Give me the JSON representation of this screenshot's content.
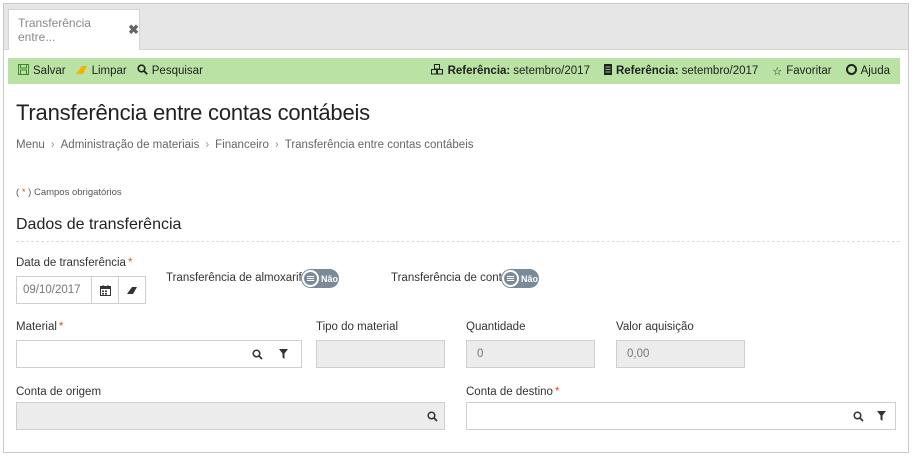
{
  "tab": {
    "label": "Transferência entre...",
    "close": "✖"
  },
  "toolbar": {
    "save_label": "Salvar",
    "clear_label": "Limpar",
    "search_label": "Pesquisar",
    "ref1_label": "Referência:",
    "ref1_value": "setembro/2017",
    "ref2_label": "Referência:",
    "ref2_value": "setembro/2017",
    "favorite_label": "Favoritar",
    "help_label": "Ajuda"
  },
  "page": {
    "title": "Transferência entre contas contábeis",
    "breadcrumb": [
      "Menu",
      "Administração de materiais",
      "Financeiro",
      "Transferência entre contas contábeis"
    ],
    "breadcrumb_sep": "›",
    "required_note_open": "( ",
    "required_note_star": "*",
    "required_note_rest": " ) Campos obrigatórios"
  },
  "section": {
    "title": "Dados de transferência"
  },
  "form": {
    "date_label": "Data de transferência",
    "date_value": "09/10/2017",
    "transfer_almox_label": "Transferência de almoxarifado",
    "transfer_almox_state": "Não",
    "transfer_contas_label": "Transferência de contas",
    "transfer_contas_state": "Não",
    "material_label": "Material",
    "tipo_material_label": "Tipo do material",
    "quantidade_label": "Quantidade",
    "quantidade_value": "0",
    "valor_label": "Valor aquisição",
    "valor_value": "0,00",
    "conta_origem_label": "Conta de origem",
    "conta_destino_label": "Conta de destino",
    "required_mark": "*"
  },
  "colors": {
    "toolbar_bg": "#b9e2a4",
    "toggle_bg": "#7a8a99",
    "required": "#e74c3c"
  }
}
